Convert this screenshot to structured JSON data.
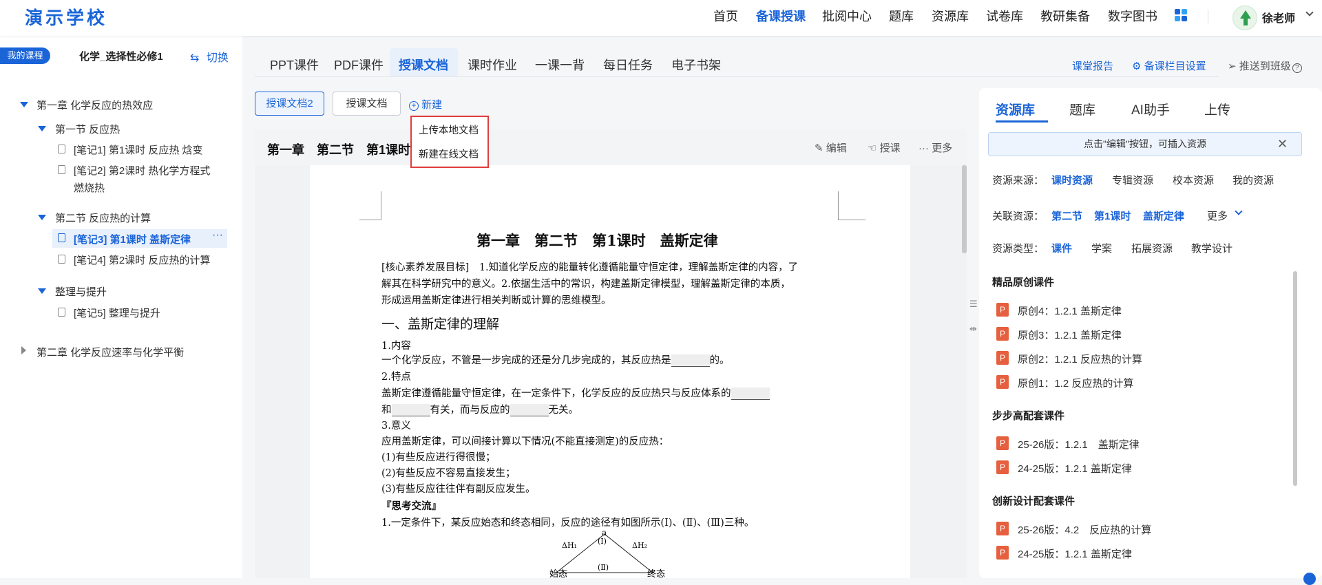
{
  "header": {
    "logo": "演示学校",
    "nav": [
      "首页",
      "备课授课",
      "批阅中心",
      "题库",
      "资源库",
      "试卷库",
      "教研集备",
      "数字图书"
    ],
    "user": "徐老师"
  },
  "left": {
    "my_course": "我的课程",
    "course_name": "化学_选择性必修1",
    "switch": "切换",
    "tree": {
      "ch1": "第一章 化学反应的热效应",
      "s1": "第一节 反应热",
      "n1": "[笔记1] 第1课时 反应热 焓变",
      "n2a": "[笔记2] 第2课时 热化学方程式",
      "n2b": "燃烧热",
      "s2": "第二节 反应热的计算",
      "n3": "[笔记3] 第1课时 盖斯定律",
      "n4": "[笔记4] 第2课时 反应热的计算",
      "s3": "整理与提升",
      "n5": "[笔记5] 整理与提升",
      "ch2": "第二章 化学反应速率与化学平衡"
    }
  },
  "tabs": [
    "PPT课件",
    "PDF课件",
    "授课文档",
    "课时作业",
    "一课一背",
    "每日任务",
    "电子书架"
  ],
  "right_links": [
    "课堂报告",
    "备课栏目设置",
    "推送到班级"
  ],
  "buttons": {
    "doc2": "授课文档2",
    "doc": "授课文档",
    "new": "新建"
  },
  "dropdown": [
    "上传本地文档",
    "新建在线文档"
  ],
  "doc_header": {
    "title": "第一章　第二节　第1课时",
    "edit": "编辑",
    "teach": "授课",
    "more": "更多"
  },
  "doc": {
    "title": "第一章　第二节　第1课时　盖斯定律",
    "l1": "[核心素养发展目标]　1.知道化学反应的能量转化遵循能量守恒定律，理解盖斯定律的内容，了",
    "l2": "解其在科学研究中的意义。2.依据生活中的常识，构建盖斯定律模型，理解盖斯定律的本质，",
    "l3": "形成运用盖斯定律进行相关判断或计算的思维模型。",
    "h1": "一、盖斯定律的理解",
    "s1": "1.内容",
    "t1a": "一个化学反应，不管是一步完成的还是分几步完成的，其反应热是",
    "t1b": "的。",
    "s2": "2.特点",
    "t2a": "盖斯定律遵循能量守恒定律，在一定条件下，化学反应的反应热只与反应体系的",
    "t3a": "和",
    "t3b": "有关，而与反应的",
    "t3c": "无关。",
    "s3": "3.意义",
    "t4": "应用盖斯定律，可以间接计算以下情况(不能直接测定)的反应热：",
    "i1": "(1)有些反应进行得很慢；",
    "i2": "(2)有些反应不容易直接发生；",
    "i3": "(3)有些反应往往伴有副反应发生。",
    "think": "『思考交流』",
    "q1": "1.一定条件下，某反应始态和终态相同，反应的途径有如图所示(Ⅰ)、(Ⅱ)、(Ⅲ)三种。",
    "fig": {
      "a": "a",
      "dh1": "ΔH₁",
      "dh2": "ΔH₂",
      "r1": "(Ⅰ)",
      "r2": "(Ⅱ)",
      "start": "始态",
      "end": "终态"
    }
  },
  "right": {
    "tabs": [
      "资源库",
      "题库",
      "AI助手",
      "上传"
    ],
    "hint": "点击\"编辑\"按钮，可插入资源",
    "src_label": "资源来源：",
    "src": [
      "课时资源",
      "专辑资源",
      "校本资源",
      "我的资源"
    ],
    "rel_label": "关联资源：",
    "rel": [
      "第二节",
      "第1课时",
      "盖斯定律"
    ],
    "rel_more": "更多",
    "type_label": "资源类型：",
    "types": [
      "课件",
      "学案",
      "拓展资源",
      "教学设计"
    ],
    "sec1": "精品原创课件",
    "r1": [
      "原创4：1.2.1 盖斯定律",
      "原创3：1.2.1 盖斯定律",
      "原创2：1.2.1 反应热的计算",
      "原创1：1.2 反应热的计算"
    ],
    "sec2": "步步高配套课件",
    "r2": [
      "25-26版：1.2.1　盖斯定律",
      "24-25版：1.2.1 盖斯定律"
    ],
    "sec3": "创新设计配套课件",
    "r3": [
      "25-26版：4.2　反应热的计算",
      "24-25版：1.2.1 盖斯定律"
    ],
    "ppt_letter": "P"
  },
  "colors": {
    "primary": "#1a64d8",
    "highlight": "#e03c3c",
    "ppt": "#e65f3e"
  }
}
